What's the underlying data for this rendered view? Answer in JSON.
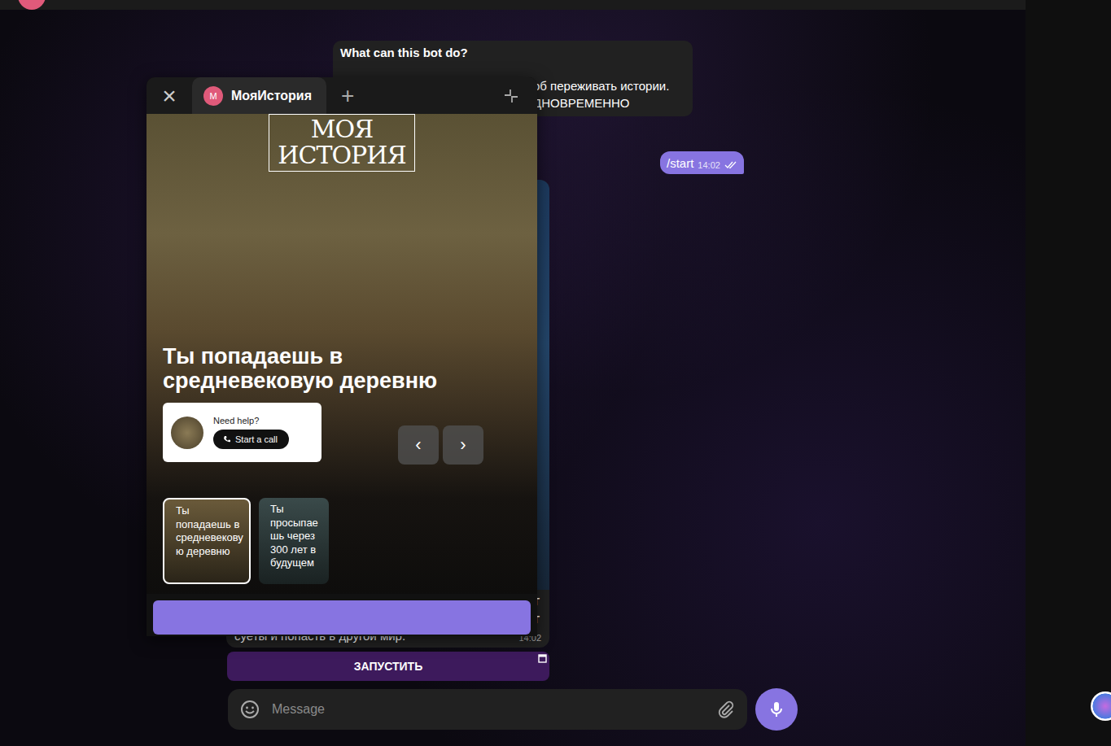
{
  "info_card": {
    "title": "What can this bot do?",
    "lines": [
      "об переживать истории.",
      "ДНОВРЕМЕННО"
    ]
  },
  "messages": [
    {
      "from": "me",
      "text": "/start",
      "time": "14:02",
      "read": true
    },
    {
      "from": "bot",
      "edge_letters": [
        "Т",
        "Т"
      ],
      "text": "суеты и попасть в другой мир.",
      "time": "14:02"
    }
  ],
  "keyboard": [
    {
      "label": "ЗАПУСТИТЬ"
    }
  ],
  "composer": {
    "placeholder": "Message"
  },
  "mini_app": {
    "close": "×",
    "add": "+",
    "tabs": [
      {
        "avatar": "М",
        "label": "МояИстория",
        "selected": true
      }
    ],
    "logo": [
      "МОЯ",
      "ИСТОРИЯ"
    ],
    "title": "Ты попадаешь в средневековую деревню",
    "help": {
      "label": "Need help?",
      "button": "Start a call"
    },
    "nav": [
      "‹",
      "›"
    ],
    "stories": [
      {
        "title": "Ты попадаешь в средневековую деревню",
        "selected": true
      },
      {
        "title": "Ты просыпаешь через 300 лет в будущем",
        "selected": false
      }
    ]
  }
}
